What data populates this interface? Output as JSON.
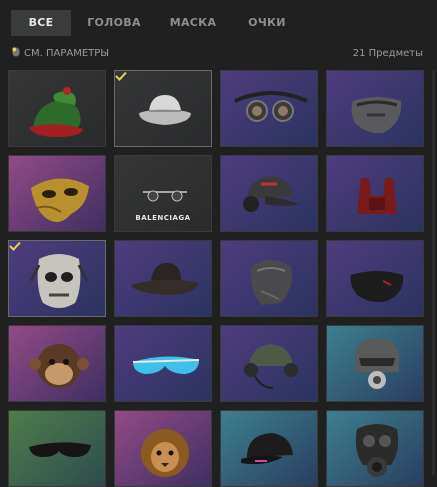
{
  "tabs": [
    {
      "label": "ВСЕ",
      "active": true
    },
    {
      "label": "ГОЛОВА",
      "active": false
    },
    {
      "label": "МАСКА",
      "active": false
    },
    {
      "label": "ОЧКИ",
      "active": false
    }
  ],
  "filter": {
    "label": "СМ. ПАРАМЕТРЫ",
    "icon": "mouse-icon"
  },
  "item_count": "21 Предметы",
  "items": [
    {
      "name": "elf-hat",
      "bg": "dark",
      "selected": false
    },
    {
      "name": "bucket-hat",
      "bg": "dark",
      "selected": true
    },
    {
      "name": "goggles",
      "bg": "purple",
      "selected": false
    },
    {
      "name": "gray-face-mask",
      "bg": "purple",
      "selected": false
    },
    {
      "name": "gold-masquerade-mask",
      "bg": "pink",
      "selected": false
    },
    {
      "name": "balenciaga-sunglasses",
      "bg": "dark",
      "selected": false,
      "brand": "BALENCIAGA"
    },
    {
      "name": "cap-with-headphones",
      "bg": "purple",
      "selected": false
    },
    {
      "name": "red-backpack-harness",
      "bg": "purple",
      "selected": false
    },
    {
      "name": "skull-mask",
      "bg": "purple",
      "selected": true
    },
    {
      "name": "cowboy-hat",
      "bg": "purple",
      "selected": false
    },
    {
      "name": "bandana-wrap",
      "bg": "purple",
      "selected": false
    },
    {
      "name": "black-face-mask",
      "bg": "purple",
      "selected": false
    },
    {
      "name": "monkey-mask",
      "bg": "pink",
      "selected": false
    },
    {
      "name": "blue-shades",
      "bg": "purple",
      "selected": false
    },
    {
      "name": "pilot-cap-headset",
      "bg": "purple",
      "selected": false
    },
    {
      "name": "helmet-respirator",
      "bg": "teal",
      "selected": false
    },
    {
      "name": "black-sunglasses",
      "bg": "green",
      "selected": false
    },
    {
      "name": "lion-mask",
      "bg": "pink",
      "selected": false
    },
    {
      "name": "black-baseball-cap",
      "bg": "teal",
      "selected": false
    },
    {
      "name": "gas-mask",
      "bg": "teal",
      "selected": false
    }
  ],
  "colors": {
    "accent_check": "#e7d25b",
    "dark": [
      "#353637",
      "#2a2b2c"
    ],
    "purple": [
      "#4f3c7e",
      "#2b3360"
    ],
    "pink": [
      "#934a86",
      "#3e2f62"
    ],
    "teal": [
      "#3d7f8f",
      "#2a3e5f"
    ],
    "green": [
      "#4f7d4a",
      "#2e4b4f"
    ]
  }
}
